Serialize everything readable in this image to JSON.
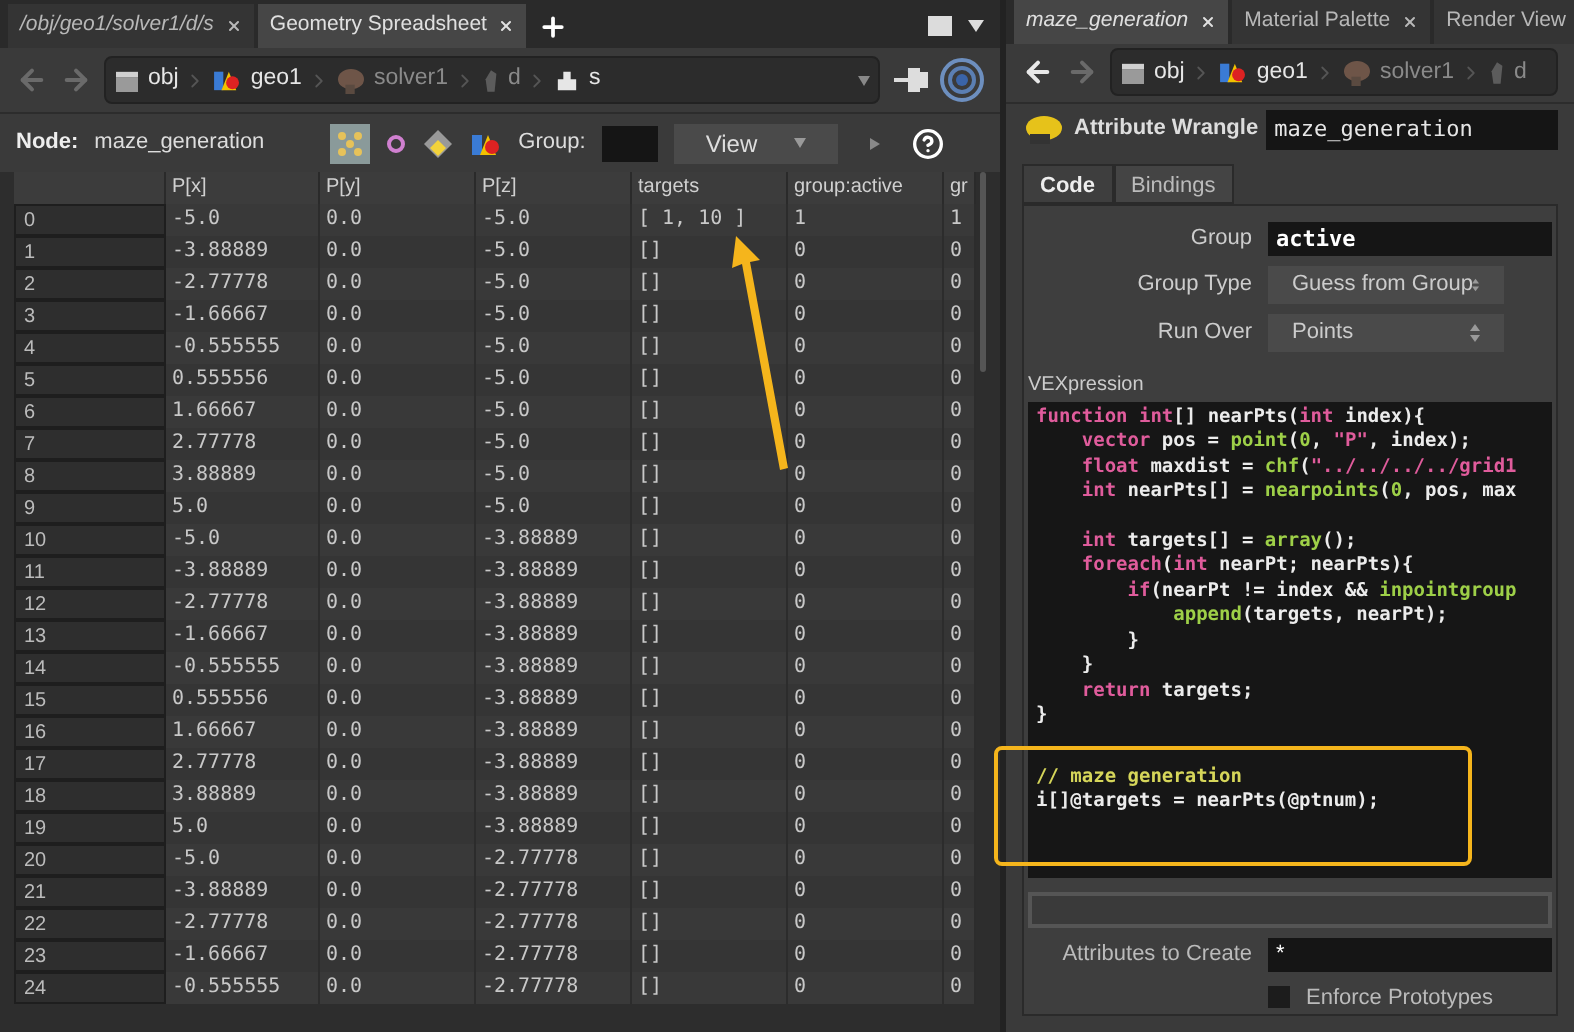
{
  "left_pane": {
    "tabs": [
      {
        "label": "/obj/geo1/solver1/d/s",
        "selected": false,
        "italic": true
      },
      {
        "label": "Geometry Spreadsheet",
        "selected": true,
        "italic": false
      }
    ],
    "path": [
      {
        "label": "obj",
        "kind": "obj",
        "dimmed": false
      },
      {
        "label": "geo1",
        "kind": "geo",
        "dimmed": false
      },
      {
        "label": "solver1",
        "kind": "solver",
        "dimmed": true
      },
      {
        "label": "d",
        "kind": "figure",
        "dimmed": true
      },
      {
        "label": "s",
        "kind": "stack",
        "dimmed": false
      }
    ],
    "node_bar": {
      "label": "Node:",
      "node": "maze_generation",
      "group_label": "Group:",
      "view": "View"
    },
    "table": {
      "columns": [
        "P[x]",
        "P[y]",
        "P[z]",
        "targets",
        "group:active",
        "gr"
      ],
      "rows": [
        {
          "index": "0",
          "cells": [
            "-5.0",
            "0.0",
            "-5.0",
            "[ 1, 10 ]",
            "1",
            "1"
          ]
        },
        {
          "index": "1",
          "cells": [
            "-3.88889",
            "0.0",
            "-5.0",
            "[]",
            "0",
            "0"
          ]
        },
        {
          "index": "2",
          "cells": [
            "-2.77778",
            "0.0",
            "-5.0",
            "[]",
            "0",
            "0"
          ]
        },
        {
          "index": "3",
          "cells": [
            "-1.66667",
            "0.0",
            "-5.0",
            "[]",
            "0",
            "0"
          ]
        },
        {
          "index": "4",
          "cells": [
            "-0.555555",
            "0.0",
            "-5.0",
            "[]",
            "0",
            "0"
          ]
        },
        {
          "index": "5",
          "cells": [
            "0.555556",
            "0.0",
            "-5.0",
            "[]",
            "0",
            "0"
          ]
        },
        {
          "index": "6",
          "cells": [
            "1.66667",
            "0.0",
            "-5.0",
            "[]",
            "0",
            "0"
          ]
        },
        {
          "index": "7",
          "cells": [
            "2.77778",
            "0.0",
            "-5.0",
            "[]",
            "0",
            "0"
          ]
        },
        {
          "index": "8",
          "cells": [
            "3.88889",
            "0.0",
            "-5.0",
            "[]",
            "0",
            "0"
          ]
        },
        {
          "index": "9",
          "cells": [
            "5.0",
            "0.0",
            "-5.0",
            "[]",
            "0",
            "0"
          ]
        },
        {
          "index": "10",
          "cells": [
            "-5.0",
            "0.0",
            "-3.88889",
            "[]",
            "0",
            "0"
          ]
        },
        {
          "index": "11",
          "cells": [
            "-3.88889",
            "0.0",
            "-3.88889",
            "[]",
            "0",
            "0"
          ]
        },
        {
          "index": "12",
          "cells": [
            "-2.77778",
            "0.0",
            "-3.88889",
            "[]",
            "0",
            "0"
          ]
        },
        {
          "index": "13",
          "cells": [
            "-1.66667",
            "0.0",
            "-3.88889",
            "[]",
            "0",
            "0"
          ]
        },
        {
          "index": "14",
          "cells": [
            "-0.555555",
            "0.0",
            "-3.88889",
            "[]",
            "0",
            "0"
          ]
        },
        {
          "index": "15",
          "cells": [
            "0.555556",
            "0.0",
            "-3.88889",
            "[]",
            "0",
            "0"
          ]
        },
        {
          "index": "16",
          "cells": [
            "1.66667",
            "0.0",
            "-3.88889",
            "[]",
            "0",
            "0"
          ]
        },
        {
          "index": "17",
          "cells": [
            "2.77778",
            "0.0",
            "-3.88889",
            "[]",
            "0",
            "0"
          ]
        },
        {
          "index": "18",
          "cells": [
            "3.88889",
            "0.0",
            "-3.88889",
            "[]",
            "0",
            "0"
          ]
        },
        {
          "index": "19",
          "cells": [
            "5.0",
            "0.0",
            "-3.88889",
            "[]",
            "0",
            "0"
          ]
        },
        {
          "index": "20",
          "cells": [
            "-5.0",
            "0.0",
            "-2.77778",
            "[]",
            "0",
            "0"
          ]
        },
        {
          "index": "21",
          "cells": [
            "-3.88889",
            "0.0",
            "-2.77778",
            "[]",
            "0",
            "0"
          ]
        },
        {
          "index": "22",
          "cells": [
            "-2.77778",
            "0.0",
            "-2.77778",
            "[]",
            "0",
            "0"
          ]
        },
        {
          "index": "23",
          "cells": [
            "-1.66667",
            "0.0",
            "-2.77778",
            "[]",
            "0",
            "0"
          ]
        },
        {
          "index": "24",
          "cells": [
            "-0.555555",
            "0.0",
            "-2.77778",
            "[]",
            "0",
            "0"
          ]
        }
      ]
    }
  },
  "right_pane": {
    "tabs": [
      {
        "label": "maze_generation",
        "selected": true,
        "italic": true
      },
      {
        "label": "Material Palette",
        "selected": false,
        "italic": false
      },
      {
        "label": "Render View",
        "selected": false,
        "italic": false
      }
    ],
    "path": [
      {
        "label": "obj",
        "kind": "obj",
        "dimmed": false
      },
      {
        "label": "geo1",
        "kind": "geo",
        "dimmed": false
      },
      {
        "label": "solver1",
        "kind": "solver",
        "dimmed": true
      },
      {
        "label": "d",
        "kind": "figure",
        "dimmed": true
      }
    ],
    "node_type": "Attribute Wrangle",
    "node_name": "maze_generation",
    "param_tabs": [
      {
        "label": "Code",
        "selected": true
      },
      {
        "label": "Bindings",
        "selected": false
      }
    ],
    "group": {
      "label": "Group",
      "value": "active"
    },
    "group_type": {
      "label": "Group Type",
      "value": "Guess from Group"
    },
    "run_over": {
      "label": "Run Over",
      "value": "Points"
    },
    "vex_label": "VEXpression",
    "code_blocks": [
      [
        [
          {
            "kind": "keyword",
            "text": "function"
          },
          {
            "kind": "keyword",
            "text": " int"
          },
          {
            "kind": "plain",
            "text": "[] nearPts("
          },
          {
            "kind": "keyword",
            "text": "int"
          },
          {
            "kind": "plain",
            "text": " index){"
          }
        ],
        [
          {
            "kind": "keyword",
            "text": "    vector"
          },
          {
            "kind": "plain",
            "text": " pos = "
          },
          {
            "kind": "function",
            "text": "point"
          },
          {
            "kind": "plain",
            "text": "("
          },
          {
            "kind": "number",
            "text": "0"
          },
          {
            "kind": "plain",
            "text": ", "
          },
          {
            "kind": "string",
            "text": "\"P\""
          },
          {
            "kind": "plain",
            "text": ", index);"
          }
        ],
        [
          {
            "kind": "keyword",
            "text": "    float"
          },
          {
            "kind": "plain",
            "text": " maxdist = "
          },
          {
            "kind": "function",
            "text": "chf"
          },
          {
            "kind": "plain",
            "text": "("
          },
          {
            "kind": "string",
            "text": "\"../../../../grid1"
          }
        ],
        [
          {
            "kind": "keyword",
            "text": "    int"
          },
          {
            "kind": "plain",
            "text": " nearPts[] = "
          },
          {
            "kind": "function",
            "text": "nearpoints"
          },
          {
            "kind": "plain",
            "text": "("
          },
          {
            "kind": "number",
            "text": "0"
          },
          {
            "kind": "plain",
            "text": ", pos, max"
          }
        ]
      ],
      [
        [
          {
            "kind": "keyword",
            "text": "    int"
          },
          {
            "kind": "plain",
            "text": " targets[] = "
          },
          {
            "kind": "function",
            "text": "array"
          },
          {
            "kind": "plain",
            "text": "();"
          }
        ],
        [
          {
            "kind": "keyword",
            "text": "    foreach"
          },
          {
            "kind": "plain",
            "text": "("
          },
          {
            "kind": "keyword",
            "text": "int"
          },
          {
            "kind": "plain",
            "text": " nearPt; nearPts){"
          }
        ],
        [
          {
            "kind": "keyword",
            "text": "        if"
          },
          {
            "kind": "plain",
            "text": "(nearPt != index && "
          },
          {
            "kind": "function",
            "text": "inpointgroup"
          }
        ],
        [
          {
            "kind": "function",
            "text": "            append"
          },
          {
            "kind": "plain",
            "text": "(targets, nearPt);"
          }
        ],
        [
          {
            "kind": "plain",
            "text": "        }"
          }
        ],
        [
          {
            "kind": "plain",
            "text": "    }"
          }
        ],
        [
          {
            "kind": "keyword",
            "text": "    return"
          },
          {
            "kind": "plain",
            "text": " targets;"
          }
        ],
        [
          {
            "kind": "plain",
            "text": "}"
          }
        ]
      ],
      [
        [
          {
            "kind": "comment",
            "text": "// maze generation"
          }
        ],
        [
          {
            "kind": "plain",
            "text": "i[]@targets = nearPts(@ptnum);"
          }
        ]
      ]
    ],
    "attributes_to_create": {
      "label": "Attributes to Create",
      "value": "*"
    },
    "enforce_prototypes": {
      "label": "Enforce Prototypes",
      "checked": false
    }
  }
}
